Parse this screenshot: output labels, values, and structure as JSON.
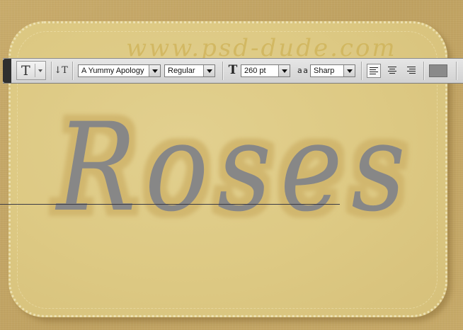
{
  "watermark": "www.psd-dude.com",
  "canvas_text": "Roses",
  "toolbar": {
    "tool_glyph": "T",
    "orientation_glyph": "↓T",
    "font_family": "A Yummy Apology",
    "font_style": "Regular",
    "size_glyph": "T",
    "font_size": "260 pt",
    "aa_glyph": "a a",
    "anti_alias": "Sharp",
    "text_color": "#8a8a8a"
  },
  "colors": {
    "background": "#c4a766",
    "card": "#ddc983",
    "text": "#878787",
    "text_glow": "#d2b872"
  }
}
